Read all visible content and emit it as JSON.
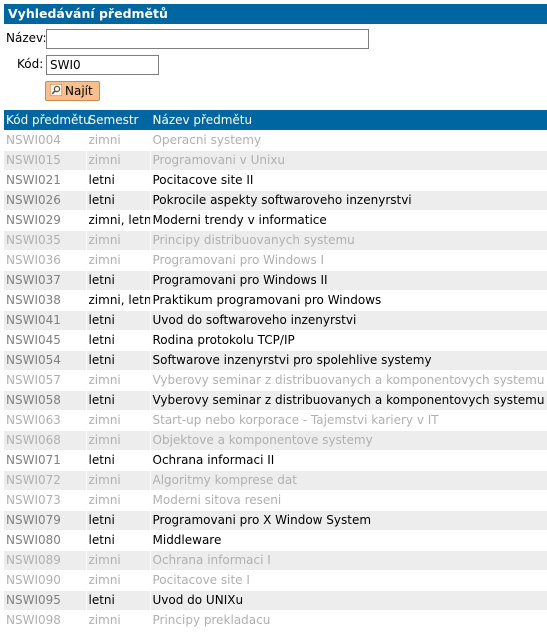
{
  "header": {
    "title": "Vyhledávání předmětů"
  },
  "search": {
    "name_label": "Název:",
    "name_value": "",
    "code_label": "Kód:",
    "code_value": "SWI0",
    "submit_label": "Najít"
  },
  "table": {
    "columns": [
      "Kód předmětu",
      "Semestr",
      "Název předmětu"
    ],
    "rows": [
      {
        "code": "NSWI004",
        "semester": "zimni",
        "name": "Operacni systemy",
        "active": false
      },
      {
        "code": "NSWI015",
        "semester": "zimni",
        "name": "Programovani v Unixu",
        "active": false
      },
      {
        "code": "NSWI021",
        "semester": "letni",
        "name": "Pocitacove site II",
        "active": true
      },
      {
        "code": "NSWI026",
        "semester": "letni",
        "name": "Pokrocile aspekty softwaroveho inzenyrstvi",
        "active": true
      },
      {
        "code": "NSWI029",
        "semester": "zimni, letni",
        "name": "Moderni trendy v informatice",
        "active": true
      },
      {
        "code": "NSWI035",
        "semester": "zimni",
        "name": "Principy distribuovanych systemu",
        "active": false
      },
      {
        "code": "NSWI036",
        "semester": "zimni",
        "name": "Programovani pro Windows I",
        "active": false
      },
      {
        "code": "NSWI037",
        "semester": "letni",
        "name": "Programovani pro Windows II",
        "active": true
      },
      {
        "code": "NSWI038",
        "semester": "zimni, letni",
        "name": "Praktikum programovani pro Windows",
        "active": true
      },
      {
        "code": "NSWI041",
        "semester": "letni",
        "name": "Uvod do softwaroveho inzenyrstvi",
        "active": true
      },
      {
        "code": "NSWI045",
        "semester": "letni",
        "name": "Rodina protokolu TCP/IP",
        "active": true
      },
      {
        "code": "NSWI054",
        "semester": "letni",
        "name": "Softwarove inzenyrstvi pro spolehlive systemy",
        "active": true
      },
      {
        "code": "NSWI057",
        "semester": "zimni",
        "name": "Vyberovy seminar z distribuovanych a komponentovych systemu I",
        "active": false
      },
      {
        "code": "NSWI058",
        "semester": "letni",
        "name": "Vyberovy seminar z distribuovanych a komponentovych systemu II",
        "active": true
      },
      {
        "code": "NSWI063",
        "semester": "zimni",
        "name": "Start-up nebo korporace - Tajemstvi kariery v IT",
        "active": false
      },
      {
        "code": "NSWI068",
        "semester": "zimni",
        "name": "Objektove a komponentove systemy",
        "active": false
      },
      {
        "code": "NSWI071",
        "semester": "letni",
        "name": "Ochrana informaci II",
        "active": true
      },
      {
        "code": "NSWI072",
        "semester": "zimni",
        "name": "Algoritmy komprese dat",
        "active": false
      },
      {
        "code": "NSWI073",
        "semester": "zimni",
        "name": "Moderni sitova reseni",
        "active": false
      },
      {
        "code": "NSWI079",
        "semester": "letni",
        "name": "Programovani pro X Window System",
        "active": true
      },
      {
        "code": "NSWI080",
        "semester": "letni",
        "name": "Middleware",
        "active": true
      },
      {
        "code": "NSWI089",
        "semester": "zimni",
        "name": "Ochrana informaci I",
        "active": false
      },
      {
        "code": "NSWI090",
        "semester": "zimni",
        "name": "Pocitacove site I",
        "active": false
      },
      {
        "code": "NSWI095",
        "semester": "letni",
        "name": "Uvod do UNIXu",
        "active": true
      },
      {
        "code": "NSWI098",
        "semester": "zimni",
        "name": "Principy prekladacu",
        "active": false
      }
    ]
  },
  "colors": {
    "header_bg": "#0066a1",
    "row_alt_bg": "#ededed",
    "inactive_text": "#b0b0b0",
    "button_bg": "#f6bf8b"
  },
  "icons": {
    "search_button_icon": "magnifier-icon"
  }
}
